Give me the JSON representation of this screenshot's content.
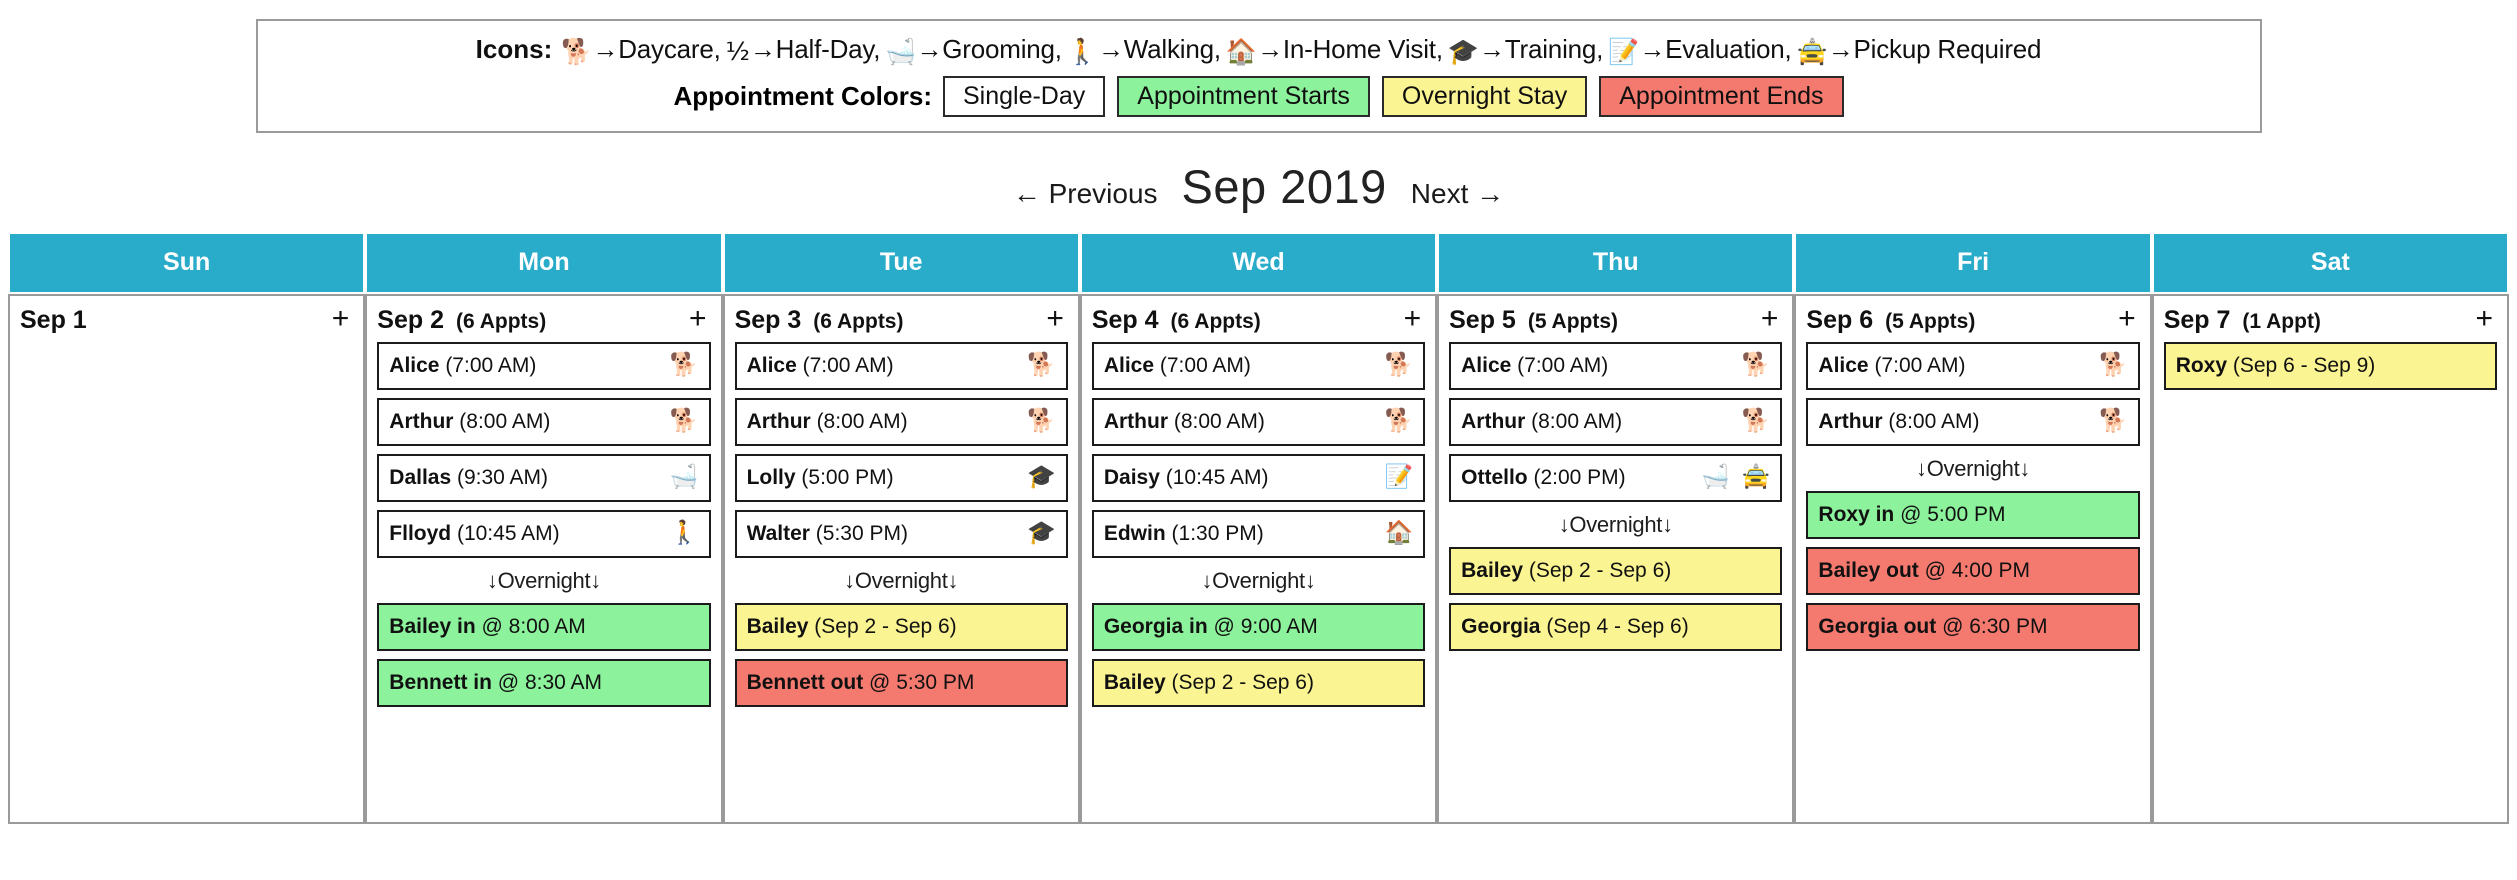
{
  "legend": {
    "icons_label": "Icons:",
    "icon_items": [
      {
        "emoji": "🐕",
        "icon_name": "dog-icon",
        "text": "→Daycare,"
      },
      {
        "emoji": "½",
        "icon_name": "half-day-icon",
        "text": "→Half-Day,"
      },
      {
        "emoji": "🛁",
        "icon_name": "bathtub-icon",
        "text": "→Grooming,"
      },
      {
        "emoji": "🚶",
        "icon_name": "walking-person-icon",
        "text": "→Walking,"
      },
      {
        "emoji": "🏠",
        "icon_name": "house-icon",
        "text": "→In-Home Visit,"
      },
      {
        "emoji": "🎓",
        "icon_name": "graduation-cap-icon",
        "text": "→Training,"
      },
      {
        "emoji": "📝",
        "icon_name": "memo-pencil-icon",
        "text": "→Evaluation,"
      },
      {
        "emoji": "🚖",
        "icon_name": "taxi-icon",
        "text": "→Pickup Required"
      }
    ],
    "colors_label": "Appointment Colors:",
    "swatches": [
      {
        "label": "Single-Day",
        "color": "#ffffff"
      },
      {
        "label": "Appointment Starts",
        "color": "#8cf29b"
      },
      {
        "label": "Overnight Stay",
        "color": "#fbf492"
      },
      {
        "label": "Appointment Ends",
        "color": "#f4796f"
      }
    ]
  },
  "nav": {
    "previous": "← Previous",
    "title": "Sep 2019",
    "next": "Next →"
  },
  "weekdays": [
    "Sun",
    "Mon",
    "Tue",
    "Wed",
    "Thu",
    "Fri",
    "Sat"
  ],
  "add_symbol": "+",
  "overnight_divider": "↓Overnight↓",
  "header_color": "#29abca",
  "days": [
    {
      "date": "Sep 1",
      "count": "",
      "appts": [],
      "overnight_divider": false,
      "overnight": []
    },
    {
      "date": "Sep 2",
      "count": "(6 Appts)",
      "appts": [
        {
          "name": "Alice",
          "meta": "(7:00 AM)",
          "icons": [
            "🐕"
          ],
          "icon_names": [
            "dog-icon"
          ],
          "color": "white"
        },
        {
          "name": "Arthur",
          "meta": "(8:00 AM)",
          "icons": [
            "🐕"
          ],
          "icon_names": [
            "dog-icon"
          ],
          "color": "white"
        },
        {
          "name": "Dallas",
          "meta": "(9:30 AM)",
          "icons": [
            "🛁"
          ],
          "icon_names": [
            "bathtub-icon"
          ],
          "color": "white"
        },
        {
          "name": "Flloyd",
          "meta": "(10:45 AM)",
          "icons": [
            "🚶"
          ],
          "icon_names": [
            "walking-person-icon"
          ],
          "color": "white"
        }
      ],
      "overnight_divider": true,
      "overnight": [
        {
          "name": "Bailey in",
          "meta": "@ 8:00 AM",
          "icons": [],
          "icon_names": [],
          "color": "green"
        },
        {
          "name": "Bennett in",
          "meta": "@ 8:30 AM",
          "icons": [],
          "icon_names": [],
          "color": "green"
        }
      ]
    },
    {
      "date": "Sep 3",
      "count": "(6 Appts)",
      "appts": [
        {
          "name": "Alice",
          "meta": "(7:00 AM)",
          "icons": [
            "🐕"
          ],
          "icon_names": [
            "dog-icon"
          ],
          "color": "white"
        },
        {
          "name": "Arthur",
          "meta": "(8:00 AM)",
          "icons": [
            "🐕"
          ],
          "icon_names": [
            "dog-icon"
          ],
          "color": "white"
        },
        {
          "name": "Lolly",
          "meta": "(5:00 PM)",
          "icons": [
            "🎓"
          ],
          "icon_names": [
            "graduation-cap-icon"
          ],
          "color": "white"
        },
        {
          "name": "Walter",
          "meta": "(5:30 PM)",
          "icons": [
            "🎓"
          ],
          "icon_names": [
            "graduation-cap-icon"
          ],
          "color": "white"
        }
      ],
      "overnight_divider": true,
      "overnight": [
        {
          "name": "Bailey",
          "meta": "(Sep 2 - Sep 6)",
          "icons": [],
          "icon_names": [],
          "color": "yellow"
        },
        {
          "name": "Bennett out",
          "meta": "@ 5:30 PM",
          "icons": [],
          "icon_names": [],
          "color": "red"
        }
      ]
    },
    {
      "date": "Sep 4",
      "count": "(6 Appts)",
      "appts": [
        {
          "name": "Alice",
          "meta": "(7:00 AM)",
          "icons": [
            "🐕"
          ],
          "icon_names": [
            "dog-icon"
          ],
          "color": "white"
        },
        {
          "name": "Arthur",
          "meta": "(8:00 AM)",
          "icons": [
            "🐕"
          ],
          "icon_names": [
            "dog-icon"
          ],
          "color": "white"
        },
        {
          "name": "Daisy",
          "meta": "(10:45 AM)",
          "icons": [
            "📝"
          ],
          "icon_names": [
            "memo-pencil-icon"
          ],
          "color": "white"
        },
        {
          "name": "Edwin",
          "meta": "(1:30 PM)",
          "icons": [
            "🏠"
          ],
          "icon_names": [
            "house-icon"
          ],
          "color": "white"
        }
      ],
      "overnight_divider": true,
      "overnight": [
        {
          "name": "Georgia in",
          "meta": "@ 9:00 AM",
          "icons": [],
          "icon_names": [],
          "color": "green"
        },
        {
          "name": "Bailey",
          "meta": "(Sep 2 - Sep 6)",
          "icons": [],
          "icon_names": [],
          "color": "yellow"
        }
      ]
    },
    {
      "date": "Sep 5",
      "count": "(5 Appts)",
      "appts": [
        {
          "name": "Alice",
          "meta": "(7:00 AM)",
          "icons": [
            "🐕"
          ],
          "icon_names": [
            "dog-icon"
          ],
          "color": "white"
        },
        {
          "name": "Arthur",
          "meta": "(8:00 AM)",
          "icons": [
            "🐕"
          ],
          "icon_names": [
            "dog-icon"
          ],
          "color": "white"
        },
        {
          "name": "Ottello",
          "meta": "(2:00 PM)",
          "icons": [
            "🛁",
            "🚖"
          ],
          "icon_names": [
            "bathtub-icon",
            "taxi-icon"
          ],
          "color": "white"
        }
      ],
      "overnight_divider": true,
      "overnight": [
        {
          "name": "Bailey",
          "meta": "(Sep 2 - Sep 6)",
          "icons": [],
          "icon_names": [],
          "color": "yellow"
        },
        {
          "name": "Georgia",
          "meta": "(Sep 4 - Sep 6)",
          "icons": [],
          "icon_names": [],
          "color": "yellow"
        }
      ]
    },
    {
      "date": "Sep 6",
      "count": "(5 Appts)",
      "appts": [
        {
          "name": "Alice",
          "meta": "(7:00 AM)",
          "icons": [
            "🐕"
          ],
          "icon_names": [
            "dog-icon"
          ],
          "color": "white"
        },
        {
          "name": "Arthur",
          "meta": "(8:00 AM)",
          "icons": [
            "🐕"
          ],
          "icon_names": [
            "dog-icon"
          ],
          "color": "white"
        }
      ],
      "overnight_divider": true,
      "overnight": [
        {
          "name": "Roxy in",
          "meta": "@ 5:00 PM",
          "icons": [],
          "icon_names": [],
          "color": "green"
        },
        {
          "name": "Bailey out",
          "meta": "@ 4:00 PM",
          "icons": [],
          "icon_names": [],
          "color": "red"
        },
        {
          "name": "Georgia out",
          "meta": "@ 6:30 PM",
          "icons": [],
          "icon_names": [],
          "color": "red"
        }
      ]
    },
    {
      "date": "Sep 7",
      "count": "(1 Appt)",
      "appts": [
        {
          "name": "Roxy",
          "meta": "(Sep 6 - Sep 9)",
          "icons": [],
          "icon_names": [],
          "color": "yellow"
        }
      ],
      "overnight_divider": false,
      "overnight": []
    }
  ]
}
